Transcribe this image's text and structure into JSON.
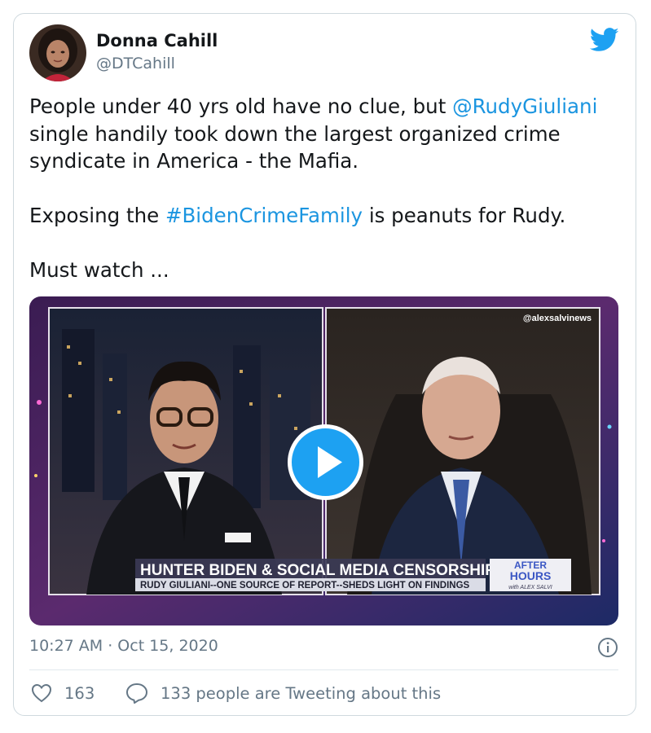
{
  "author": {
    "display_name": "Donna Cahill",
    "handle": "@DTCahill"
  },
  "tweet": {
    "line1_before": "People under 40 yrs old have no clue, but ",
    "mention": "@RudyGiuliani",
    "line1_after": " single handily took down the largest organized crime syndicate in America - the Mafia.",
    "line2_before": "Exposing the ",
    "hashtag": "#BidenCrimeFamily",
    "line2_after": " is peanuts for Rudy.",
    "line3": "Must watch ..."
  },
  "video": {
    "watermark": "@alexsalvinews",
    "headline": "HUNTER BIDEN & SOCIAL MEDIA CENSORSHIP",
    "subheadline": "RUDY GIULIANI--ONE SOURCE OF REPORT--SHEDS LIGHT ON FINDINGS",
    "show_logo_line1": "AFTER",
    "show_logo_line2": "HOURS",
    "show_logo_line3": "with ALEX SALVI"
  },
  "meta": {
    "timestamp": "10:27 AM · Oct 15, 2020"
  },
  "actions": {
    "like_count": "163",
    "reply_text": "133 people are Tweeting about this"
  },
  "colors": {
    "link": "#1b95e0",
    "twitter_blue": "#1da1f2",
    "muted": "#657786"
  },
  "icons": [
    "twitter-logo-icon",
    "play-icon",
    "info-icon",
    "heart-icon",
    "speech-bubble-icon"
  ]
}
